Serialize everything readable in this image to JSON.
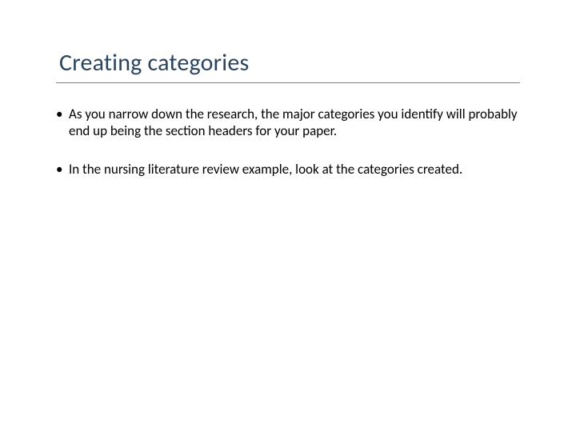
{
  "slide": {
    "title": "Creating categories",
    "bullets": [
      "As you narrow down the research, the major categories you identify will probably end up being the section headers for your paper.",
      "In the nursing literature review example, look at the categories created."
    ]
  }
}
